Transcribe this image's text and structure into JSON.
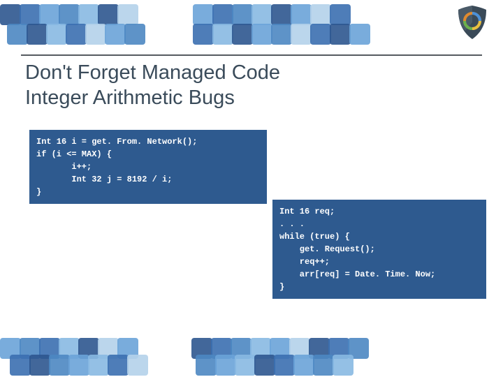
{
  "title_line1": "Don't Forget Managed Code",
  "title_line2": "Integer Arithmetic Bugs",
  "code1": "Int 16 i = get. From. Network();\nif (i <= MAX) {\n       i++;\n       Int 32 j = 8192 / i;\n}",
  "code2": "Int 16 req;\n. . .\nwhile (true) {\n    get. Request();\n    req++;\n    arr[req] = Date. Time. Now;\n}",
  "logo_name": "shield-logo"
}
